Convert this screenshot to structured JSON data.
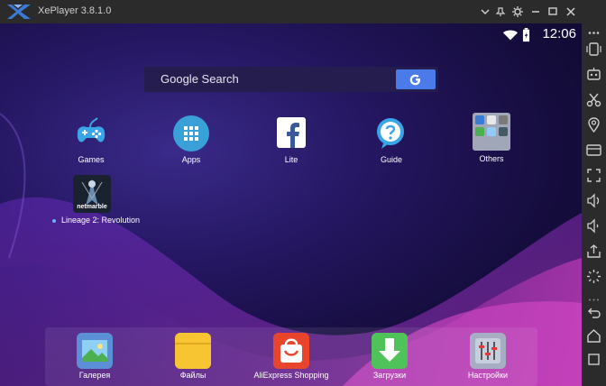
{
  "window": {
    "title": "XePlayer 3.8.1.0"
  },
  "status_bar": {
    "time": "12:06"
  },
  "search": {
    "placeholder": "Google Search"
  },
  "apps": [
    {
      "label": "Games",
      "icon": "gamepad-icon"
    },
    {
      "label": "Apps",
      "icon": "app-grid-icon"
    },
    {
      "label": "Lite",
      "icon": "facebook-icon"
    },
    {
      "label": "Guide",
      "icon": "help-icon"
    },
    {
      "label": "Others",
      "icon": "folder-icon"
    },
    {
      "label": "Lineage 2: Revolution",
      "icon": "netmarble-icon",
      "icon_text": "netmarble"
    }
  ],
  "dock": [
    {
      "label": "Галерея",
      "icon": "gallery-icon"
    },
    {
      "label": "Файлы",
      "icon": "files-icon"
    },
    {
      "label": "AliExpress Shopping",
      "icon": "aliexpress-icon"
    },
    {
      "label": "Загрузки",
      "icon": "downloads-icon"
    },
    {
      "label": "Настройки",
      "icon": "settings-icon"
    }
  ],
  "colors": {
    "titlebar": "#2b2b2b",
    "search_button": "#4a7be8",
    "wallpaper": "#241660"
  }
}
